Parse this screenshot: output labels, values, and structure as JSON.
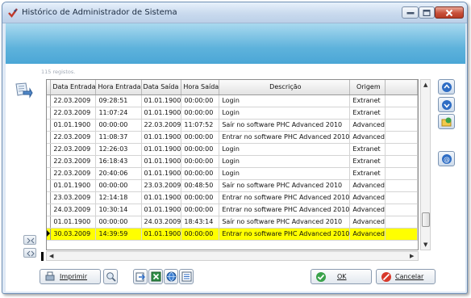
{
  "window": {
    "title": "Histórico de Administrador de Sistema"
  },
  "registos": "115 registos.",
  "table": {
    "columns": [
      "Data Entrada",
      "Hora Entrada",
      "Data Saída",
      "Hora Saída",
      "Descrição",
      "Origem"
    ],
    "rows": [
      [
        "22.03.2009",
        "09:28:51",
        "01.01.1900",
        "00:00:00",
        "Login",
        "Extranet"
      ],
      [
        "22.03.2009",
        "11:07:24",
        "01.01.1900",
        "00:00:00",
        "Login",
        "Extranet"
      ],
      [
        "01.01.1900",
        "00:00:00",
        "22.03.2009",
        "11:07:52",
        "Saír no software PHC Advanced 2010",
        "Advanced"
      ],
      [
        "22.03.2009",
        "11:08:37",
        "01.01.1900",
        "00:00:00",
        "Entrar no software PHC Advanced 2010",
        "Advanced"
      ],
      [
        "22.03.2009",
        "12:26:03",
        "01.01.1900",
        "00:00:00",
        "Login",
        "Extranet"
      ],
      [
        "22.03.2009",
        "16:18:43",
        "01.01.1900",
        "00:00:00",
        "Login",
        "Extranet"
      ],
      [
        "22.03.2009",
        "20:40:06",
        "01.01.1900",
        "00:00:00",
        "Login",
        "Extranet"
      ],
      [
        "01.01.1900",
        "00:00:00",
        "23.03.2009",
        "00:48:50",
        "Saír no software PHC Advanced 2010",
        "Advanced"
      ],
      [
        "23.03.2009",
        "12:14:18",
        "01.01.1900",
        "00:00:00",
        "Entrar no software PHC Advanced 2010",
        "Advanced"
      ],
      [
        "24.03.2009",
        "10:30:14",
        "01.01.1900",
        "00:00:00",
        "Entrar no software PHC Advanced 2010",
        "Advanced"
      ],
      [
        "01.01.1900",
        "00:00:00",
        "24.03.2009",
        "18:43:14",
        "Saír no software PHC Advanced 2010",
        "Advanced"
      ],
      [
        "30.03.2009",
        "14:39:59",
        "01.01.1900",
        "00:00:00",
        "Entrar no software PHC Advanced 2010",
        "Advanced"
      ]
    ],
    "selected_row": 11
  },
  "footer": {
    "imprimir": "Imprimir",
    "ok": "OK",
    "cancelar": "Cancelar"
  },
  "colors": {
    "selected_row": "#ffff00",
    "header_band": "#5fb3dc"
  },
  "icons": {
    "app": "check-pen-icon",
    "side": "document-arrow-icon",
    "right": [
      "arrow-up-icon",
      "arrow-down-icon",
      "folder-refresh-icon",
      "help-icon"
    ]
  }
}
